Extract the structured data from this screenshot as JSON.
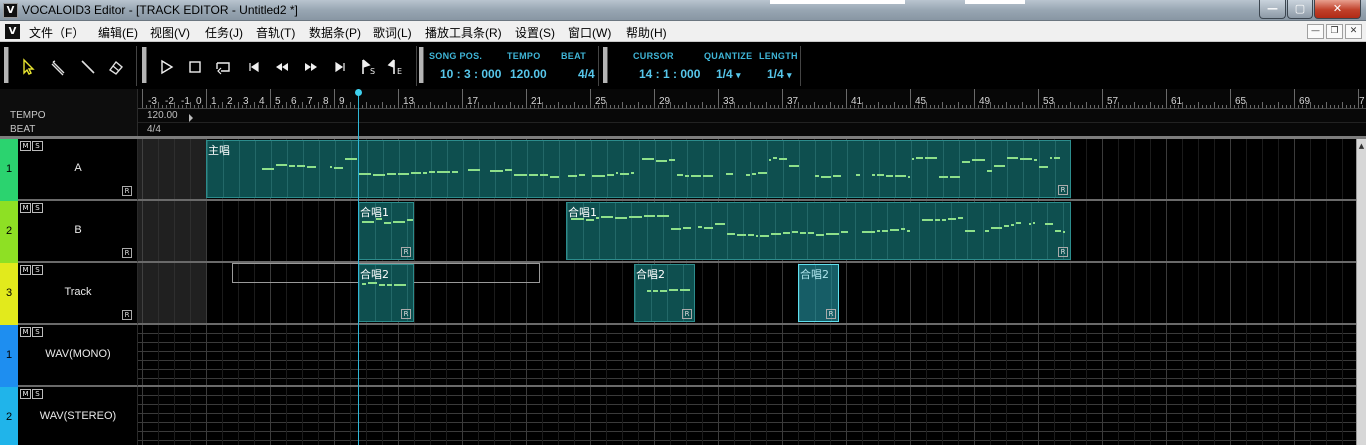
{
  "window": {
    "icon_letter": "V",
    "title": "VOCALOID3 Editor - [TRACK EDITOR - Untitled2 *]",
    "minimize_glyph": "—",
    "maximize_glyph": "▢",
    "close_glyph": "✕"
  },
  "menubar": {
    "logo": "V",
    "items": [
      "文件（F）",
      "编辑(E)",
      "视图(V)",
      "任务(J)",
      "音轨(T)",
      "数据条(P)",
      "歌词(L)",
      "播放工具条(R)",
      "设置(S)",
      "窗口(W)",
      "帮助(H)"
    ],
    "mdi_minimize": "—",
    "mdi_restore": "❐",
    "mdi_close": "✕"
  },
  "toolbar": {
    "song_pos_label": "SONG POS.",
    "song_pos_value": "10 : 3 : 000",
    "tempo_label": "TEMPO",
    "tempo_value": "120.00",
    "beat_label": "BEAT",
    "beat_value": "4/4",
    "cursor_label": "CURSOR",
    "cursor_value": "14 : 1 : 000",
    "quantize_label": "QUANTIZE",
    "quantize_value": "1/4",
    "length_label": "LENGTH",
    "length_value": "1/4",
    "dropdown_glyph": "▾"
  },
  "ruler": {
    "measures": [
      "-3",
      "-2",
      "-1",
      "0",
      "1",
      "2",
      "3",
      "4",
      "5",
      "6",
      "7",
      "8",
      "9",
      "13",
      "17",
      "21",
      "25",
      "29",
      "33",
      "37",
      "41",
      "45",
      "49",
      "53",
      "57",
      "61",
      "65",
      "69",
      "7"
    ],
    "tempo_label": "TEMPO",
    "tempo_value": "120.00",
    "beat_label": "BEAT",
    "beat_value": "4/4"
  },
  "colors": {
    "part_fill": "#0e4f4f",
    "part_border": "#2c8c8c",
    "note": "#8ee08a",
    "playhead": "#2fb7d6",
    "track1": "#2bd36f",
    "track2": "#8ee024",
    "track3": "#e2ea1c",
    "wav1": "#1e8ef0",
    "wav2": "#20b4ea"
  },
  "tracks": [
    {
      "number": "1",
      "name": "A",
      "mute": "M",
      "solo": "S",
      "r": "R"
    },
    {
      "number": "2",
      "name": "B",
      "mute": "M",
      "solo": "S",
      "r": "R"
    },
    {
      "number": "3",
      "name": "Track",
      "mute": "M",
      "solo": "S",
      "r": "R"
    },
    {
      "number": "1",
      "name": "WAV(MONO)",
      "mute": "M",
      "solo": "S"
    },
    {
      "number": "2",
      "name": "WAV(STEREO)",
      "mute": "M",
      "solo": "S"
    }
  ],
  "parts": {
    "a_main": "主唱",
    "b_chorus1_a": "合唱1",
    "b_chorus1_b": "合唱1",
    "t_chorus2_a": "合唱2",
    "t_chorus2_b": "合唱2",
    "t_chorus2_c": "合唱2",
    "r": "R"
  },
  "scrollbar": {
    "up_glyph": "▲"
  }
}
